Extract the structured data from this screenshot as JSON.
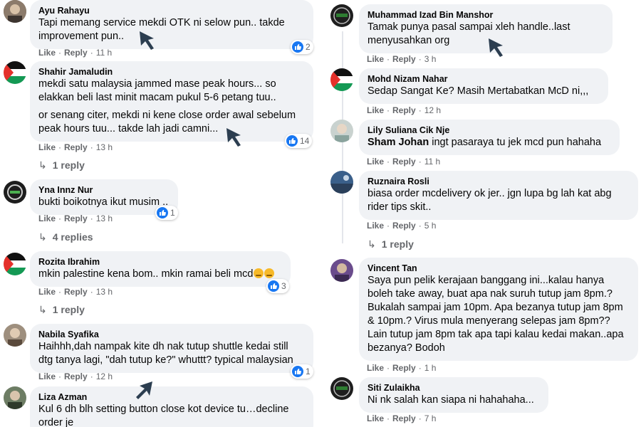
{
  "actions": {
    "like": "Like",
    "reply": "Reply"
  },
  "colors": {
    "bubble": "#f0f2f5",
    "like_badge": "#1877f2",
    "meta_text": "#65676b",
    "cursor": "#2c3e50"
  },
  "comments": [
    {
      "name": "Ayu Rahayu",
      "lines": [
        "Tapi memang service mekdi OTK ni selow pun.. takde\nimprovement pun.."
      ],
      "time": "11 h",
      "reactions": "2",
      "avatar_icon": "avatar-photo-icon"
    },
    {
      "name": "Shahir Jamaludin",
      "lines": [
        "mekdi satu malaysia jammed mase peak hours... so\nelakkan beli last minit macam pukul 5-6 petang tuu..",
        "or senang citer, mekdi ni kene close order awal sebelum\npeak hours tuu... takde lah jadi camni..."
      ],
      "time": "13 h",
      "reactions": "14",
      "replies": "1 reply",
      "avatar_icon": "palestine-flag-icon"
    },
    {
      "name": "Yna Innz Nur",
      "lines": [
        "bukti boikotnya ikut musim .."
      ],
      "time": "13 h",
      "reactions": "1",
      "replies": "4 replies",
      "avatar_icon": "avatar-photo-icon"
    },
    {
      "name": "Rozita Ibrahim",
      "lines": [
        "mkin palestine kena bom.. mkin ramai beli mcd"
      ],
      "time": "13 h",
      "reactions": "3",
      "replies": "1 reply",
      "avatar_icon": "palestine-flag-icon"
    },
    {
      "name": "Nabila Syafika",
      "lines": [
        "Haihhh,dah nampak kite dh nak tutup shuttle kedai still\ndtg tanya lagi, \"dah tutup ke?\" whuttt? typical malaysian"
      ],
      "time": "12 h",
      "reactions": "1",
      "avatar_icon": "avatar-photo-icon"
    },
    {
      "name": "Liza Azman",
      "lines": [
        "Kul 6 dh blh setting button close kot device tu…decline\norder je"
      ],
      "avatar_icon": "avatar-photo-icon"
    },
    {
      "name": "Muhammad Izad Bin Manshor",
      "lines": [
        "Tamak punya pasal sampai xleh handle..last\nmenyusahkan org"
      ],
      "time": "3 h",
      "avatar_icon": "avatar-photo-icon"
    },
    {
      "name": "Mohd Nizam Nahar",
      "lines": [
        "Sedap Sangat Ke? Masih Mertabatkan McD ni,,,"
      ],
      "time": "12 h",
      "avatar_icon": "palestine-flag-icon"
    },
    {
      "name": "Lily Suliana Cik Nje",
      "mention": "Sham Johan",
      "lines": [
        " ingt pasaraya tu jek mcd pun hahaha"
      ],
      "time": "11 h",
      "avatar_icon": "avatar-photo-icon"
    },
    {
      "name": "Ruznaira Rosli",
      "lines": [
        "biasa order mcdelivery ok jer.. jgn lupa bg lah kat abg\nrider tips skit.."
      ],
      "time": "5 h",
      "replies": "1 reply",
      "avatar_icon": "avatar-photo-icon"
    },
    {
      "name": "Vincent Tan",
      "lines": [
        "Saya pun pelik kerajaan banggang ini...kalau hanya\nboleh take away, buat apa nak suruh tutup jam 8pm.?\nBukalah sampai jam 10pm. Apa bezanya tutup jam 8pm\n& 10pm.? Virus mula menyerang selepas jam 8pm??\nLain tutup jam 8pm tak apa tapi kalau kedai makan..apa\nbezanya? Bodoh"
      ],
      "time": "1 h",
      "avatar_icon": "avatar-photo-icon"
    },
    {
      "name": "Siti Zulaikha",
      "lines": [
        "Ni nk salah kan siapa ni hahahaha..."
      ],
      "time": "7 h",
      "avatar_icon": "avatar-photo-icon"
    }
  ]
}
